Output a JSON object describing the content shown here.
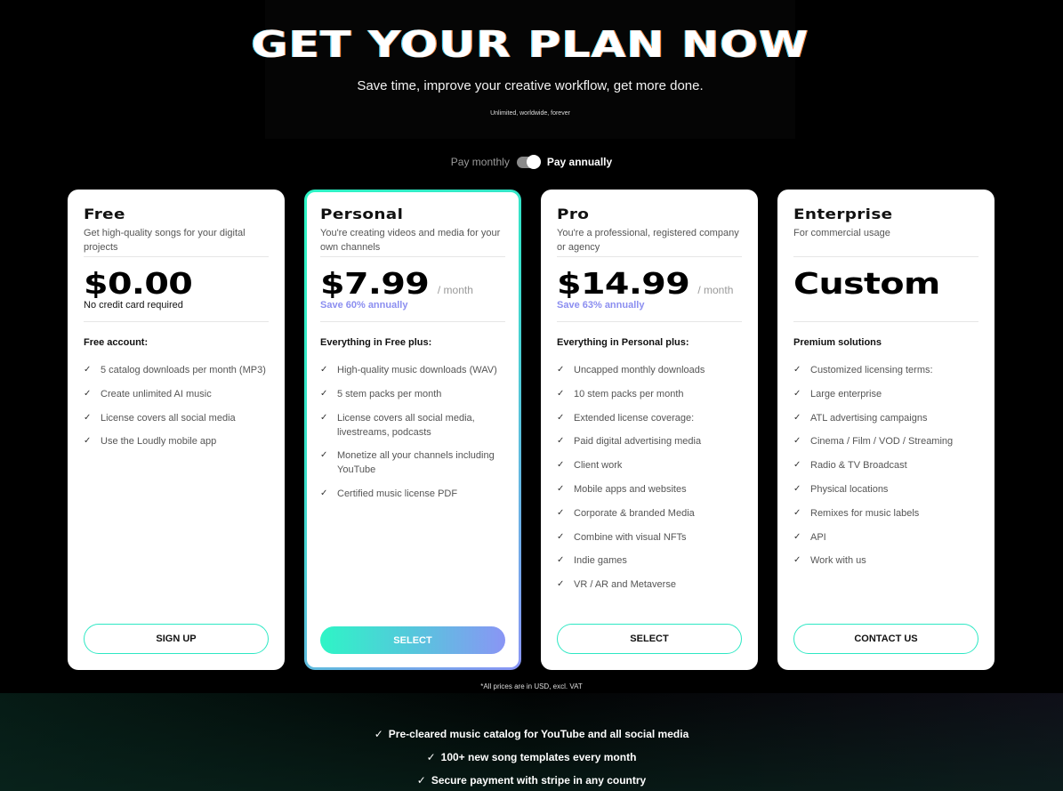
{
  "hero": {
    "title": "GET YOUR PLAN NOW",
    "subtitle": "Save time, improve your creative workflow, get more done.",
    "tagline": "Unlimited, worldwide, forever"
  },
  "billing_toggle": {
    "monthly_label": "Pay monthly",
    "annually_label": "Pay annually",
    "selected": "annually"
  },
  "plans": [
    {
      "name": "Free",
      "description": "Get high-quality songs for your digital projects",
      "price": "$0.00",
      "period": "",
      "price_note": "No credit card required",
      "section_title": "Free account:",
      "features": [
        "5 catalog downloads per month (MP3)",
        "Create unlimited AI music",
        "License covers all social media",
        "Use the Loudly mobile app"
      ],
      "cta": "SIGN UP"
    },
    {
      "name": "Personal",
      "description": "You're creating videos and media for your own channels",
      "price": "$7.99",
      "period": "/ month",
      "price_note": "Save 60% annually",
      "section_title": "Everything in Free plus:",
      "features": [
        "High-quality music downloads (WAV)",
        "5 stem packs per month",
        "License covers all social media, livestreams, podcasts",
        "Monetize all your channels including YouTube",
        "Certified music license PDF"
      ],
      "cta": "SELECT",
      "featured": true
    },
    {
      "name": "Pro",
      "description": "You're a professional, registered company or agency",
      "price": "$14.99",
      "period": "/ month",
      "price_note": "Save 63% annually",
      "section_title": "Everything in Personal plus:",
      "features": [
        "Uncapped monthly downloads",
        "10 stem packs per month",
        "Extended license coverage:",
        "Paid digital advertising media",
        "Client work",
        "Mobile apps and websites",
        "Corporate & branded Media",
        "Combine with visual NFTs",
        "Indie games",
        "VR / AR and Metaverse"
      ],
      "cta": "SELECT"
    },
    {
      "name": "Enterprise",
      "description": "For commercial usage",
      "price": "Custom",
      "period": "",
      "price_note": "",
      "section_title": "Premium solutions",
      "features": [
        "Customized licensing terms:",
        "Large enterprise",
        "ATL advertising campaigns",
        "Cinema / Film / VOD / Streaming",
        "Radio & TV Broadcast",
        "Physical locations",
        "Remixes for music labels",
        "API",
        "Work with us"
      ],
      "cta": "CONTACT US"
    }
  ],
  "footnote": "*All prices are in USD, excl. VAT",
  "benefits": [
    "Pre-cleared music catalog for YouTube and all social media",
    "100+ new song templates every month",
    "Secure payment with stripe in any country"
  ],
  "icons": {
    "check": "✓"
  },
  "colors": {
    "accent_teal": "#2ef5c6",
    "accent_violet": "#8a95f5",
    "save_text": "#8b8ef0",
    "background": "#000000"
  }
}
